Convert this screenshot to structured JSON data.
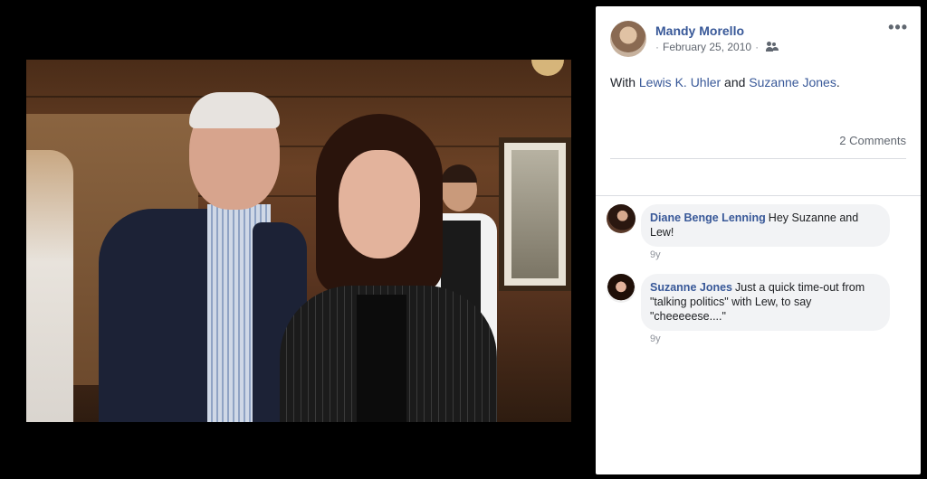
{
  "post": {
    "author": "Mandy Morello",
    "date": "February 25, 2010",
    "audience_icon": "friends-icon",
    "more_label": "•••",
    "caption_prefix": "With ",
    "tag1": "Lewis K. Uhler",
    "caption_and": " and ",
    "tag2": "Suzanne Jones",
    "caption_suffix": ".",
    "comments_count": "2 Comments"
  },
  "comments": [
    {
      "name": "Diane Benge Lenning",
      "text_line1": "Hey Suzanne and",
      "text_line2": "Lew!",
      "time": "9y"
    },
    {
      "name": "Suzanne Jones",
      "text_line1": "Just a quick time-out from",
      "text_line2": "\"talking politics\" with Lew, to say",
      "text_line3": "\"cheeeeese....\"",
      "time": "9y"
    }
  ],
  "colors": {
    "link": "#385898",
    "background": "#000000",
    "panel": "#ffffff",
    "bubble": "#f2f3f5"
  }
}
